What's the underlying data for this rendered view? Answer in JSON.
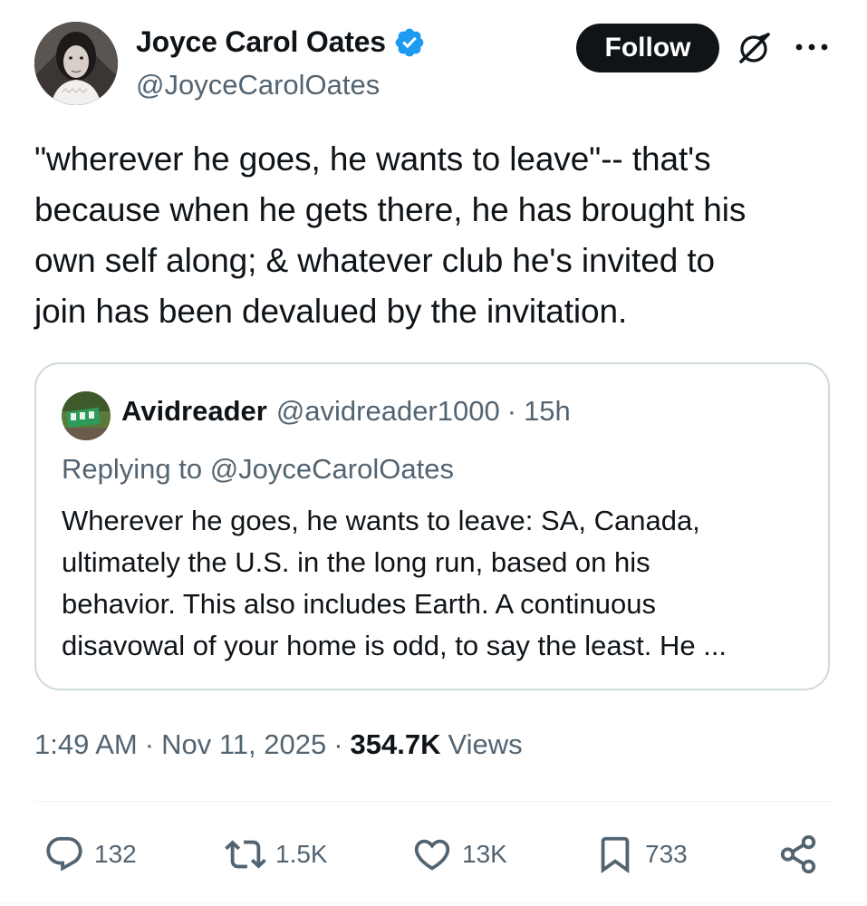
{
  "author": {
    "name": "Joyce Carol Oates",
    "handle": "@JoyceCarolOates",
    "verified": true,
    "avatar_icon": "author-portrait"
  },
  "header": {
    "follow_label": "Follow",
    "grok_icon": "grok-icon",
    "more_icon": "more-icon"
  },
  "tweet": {
    "text": "\"wherever he goes, he wants to leave\"-- that's\nbecause when he gets there, he has brought his\nown self along; & whatever club he's invited to\njoin has been devalued by the invitation."
  },
  "quote": {
    "name": "Avidreader",
    "handle": "@avidreader1000",
    "separator": "·",
    "time": "15h",
    "replying_to": "Replying to @JoyceCarolOates",
    "text": "Wherever he goes, he wants to leave: SA, Canada,\nultimately the U.S. in the long run, based on his\nbehavior. This also includes Earth. A continuous\ndisavowal of your home is odd, to say the least. He ..."
  },
  "meta": {
    "time": "1:49 AM",
    "date": "Nov 11, 2025",
    "separator": "·",
    "views_count": "354.7K",
    "views_label": "Views"
  },
  "actions": {
    "replies": "132",
    "reposts": "1.5K",
    "likes": "13K",
    "bookmarks": "733"
  },
  "colors": {
    "verified_blue": "#1d9bf0",
    "text_primary": "#0f1419",
    "text_secondary": "#536471",
    "border": "#cfd9de",
    "follow_bg": "#0f1419"
  }
}
